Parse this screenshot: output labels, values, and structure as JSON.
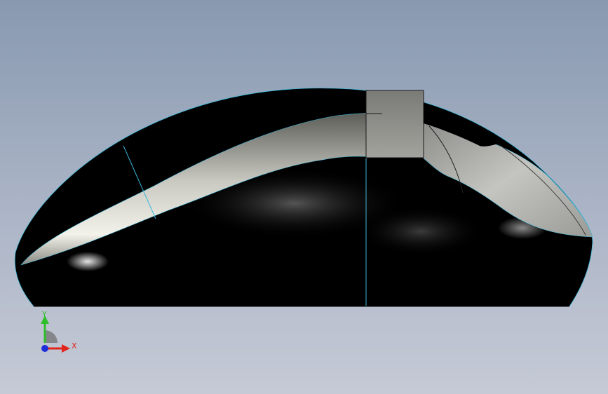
{
  "triad": {
    "x_label": "X",
    "y_label": "Y",
    "x_color": "#e0231b",
    "y_color": "#2fbf2a",
    "z_color": "#1e2fd8"
  },
  "colors": {
    "background_top": "#8899b0",
    "background_bottom": "#c6cad6",
    "body_color": "#000000",
    "edge_color": "#3ab6d9",
    "button_color": "#b7b7b4"
  },
  "model": {
    "icon": "computer-mouse-3d-model"
  }
}
